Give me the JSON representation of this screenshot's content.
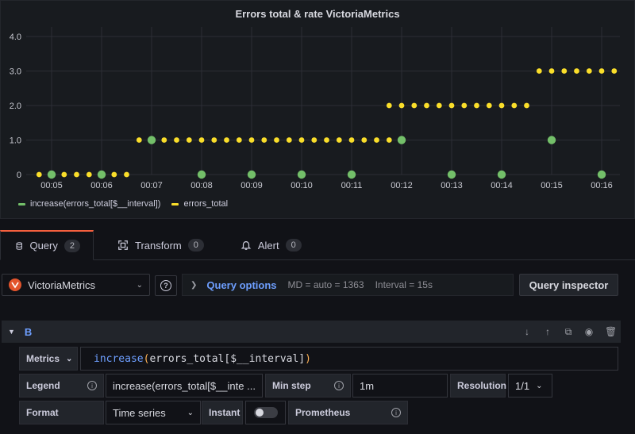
{
  "panel": {
    "title": "Errors total & rate VictoriaMetrics"
  },
  "chart_data": {
    "type": "scatter",
    "title": "Errors total & rate VictoriaMetrics",
    "ylim": [
      0,
      4
    ],
    "y_ticks": [
      "4.0",
      "3.0",
      "2.0",
      "1.0",
      "0"
    ],
    "x_ticks": [
      "00:05",
      "00:06",
      "00:07",
      "00:08",
      "00:09",
      "00:10",
      "00:11",
      "00:12",
      "00:13",
      "00:14",
      "00:15",
      "00:16"
    ],
    "grid": true,
    "legend_position": "bottom",
    "series": [
      {
        "name": "increase(errors_total[$__interval])",
        "color": "#73bf69",
        "x": [
          "00:05",
          "00:06",
          "00:07",
          "00:08",
          "00:09",
          "00:10",
          "00:11",
          "00:12",
          "00:13",
          "00:14",
          "00:15",
          "00:16"
        ],
        "values": [
          0,
          0,
          1,
          0,
          0,
          0,
          0,
          1,
          0,
          0,
          1,
          0
        ]
      },
      {
        "name": "errors_total",
        "color": "#fade2a",
        "sample_interval": "15s",
        "segments": [
          {
            "from": "00:04:45",
            "to": "00:06:30",
            "value": 0
          },
          {
            "from": "00:06:45",
            "to": "00:11:45",
            "value": 1
          },
          {
            "from": "00:11:45",
            "to": "00:14:30",
            "value": 2
          },
          {
            "from": "00:14:45",
            "to": "00:16:15",
            "value": 3
          }
        ]
      }
    ]
  },
  "legend": [
    {
      "label": "increase(errors_total[$__interval])",
      "color": "#73bf69"
    },
    {
      "label": "errors_total",
      "color": "#fade2a"
    }
  ],
  "tabs": [
    {
      "label": "Query",
      "count": "2",
      "icon": "database-icon"
    },
    {
      "label": "Transform",
      "count": "0",
      "icon": "transform-icon"
    },
    {
      "label": "Alert",
      "count": "0",
      "icon": "bell-icon"
    }
  ],
  "toolbar": {
    "datasource": "VictoriaMetrics",
    "query_options_label": "Query options",
    "md": "MD = auto = 1363",
    "interval": "Interval = 15s",
    "inspector_label": "Query inspector"
  },
  "query": {
    "name": "B",
    "metrics_label": "Metrics",
    "expr_fn": "increase",
    "expr_open": "(",
    "expr_body": "errors_total[$__interval]",
    "expr_close": ")",
    "legend_label": "Legend",
    "legend_value": "increase(errors_total[$__inte ...",
    "min_step_label": "Min step",
    "min_step_value": "1m",
    "resolution_label": "Resolution",
    "resolution_value": "1/1",
    "format_label": "Format",
    "format_value": "Time series",
    "instant_label": "Instant",
    "prometheus_label": "Prometheus"
  }
}
